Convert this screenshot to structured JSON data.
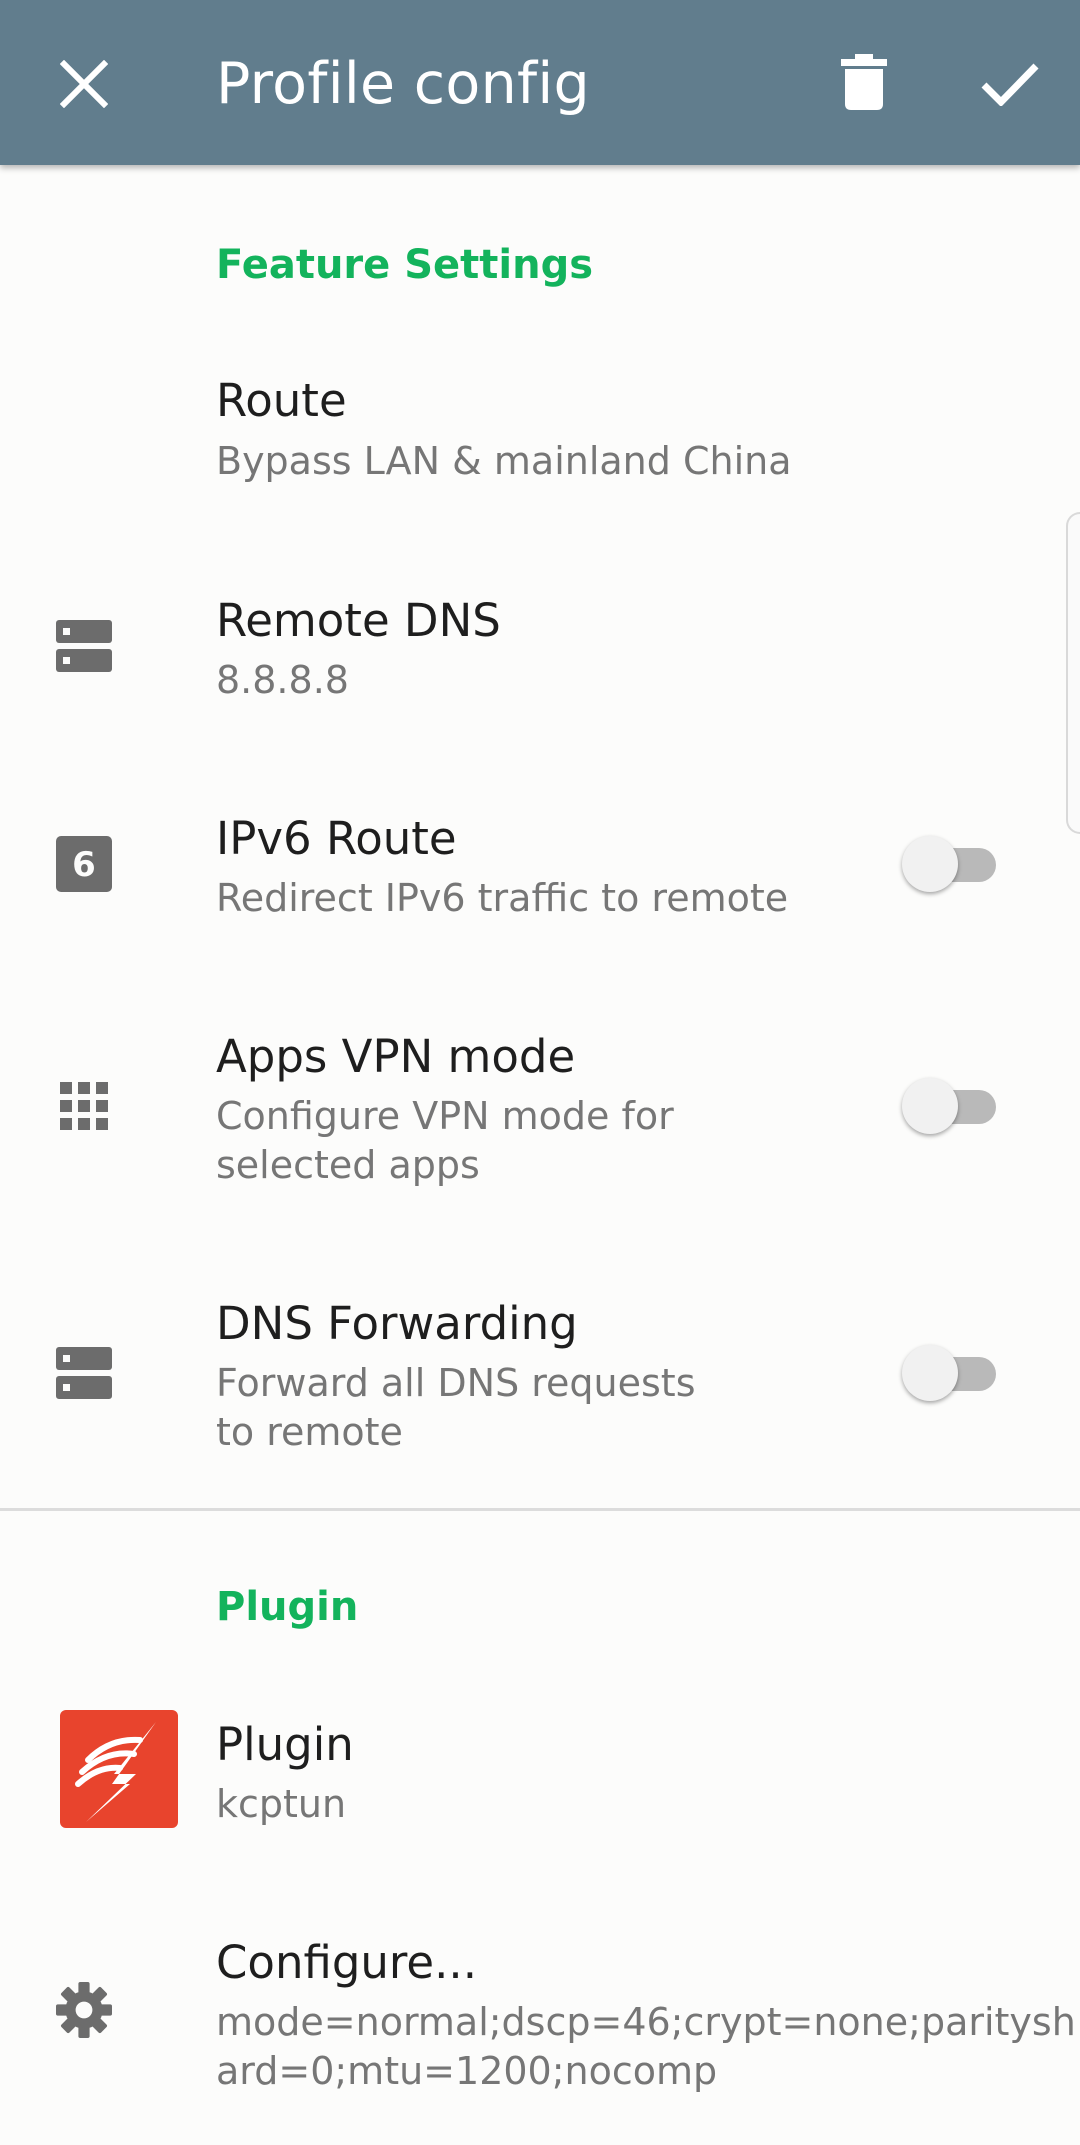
{
  "header": {
    "title": "Profile config",
    "close_icon": "close-icon",
    "delete_icon": "delete-icon",
    "save_icon": "check-icon",
    "bg_color": "#617d8d"
  },
  "accent_color": "#13b35c",
  "sections": {
    "feature": {
      "header": "Feature Settings",
      "route": {
        "title": "Route",
        "summary": "Bypass LAN & mainland China"
      },
      "remote_dns": {
        "title": "Remote DNS",
        "summary": "8.8.8.8",
        "icon": "dns-server-icon"
      },
      "ipv6": {
        "title": "IPv6 Route",
        "summary": "Redirect IPv6 traffic to remote",
        "icon": "ipv6-icon",
        "icon_text": "6",
        "enabled": false
      },
      "apps_vpn": {
        "title": "Apps VPN mode",
        "summary_line1": "Configure VPN mode for",
        "summary_line2": "selected apps",
        "icon": "apps-grid-icon",
        "enabled": false
      },
      "dns_forwarding": {
        "title": "DNS Forwarding",
        "summary_line1": "Forward all DNS requests",
        "summary_line2": "to remote",
        "icon": "dns-server-icon",
        "enabled": false
      }
    },
    "plugin": {
      "header": "Plugin",
      "plugin": {
        "title": "Plugin",
        "summary": "kcptun",
        "icon": "kcptun-logo-icon"
      },
      "configure": {
        "title": "Configure...",
        "summary_line1": "mode=normal;dscp=46;crypt=none;paritysh",
        "summary_line2": "ard=0;mtu=1200;nocomp",
        "icon": "gear-icon"
      }
    }
  }
}
